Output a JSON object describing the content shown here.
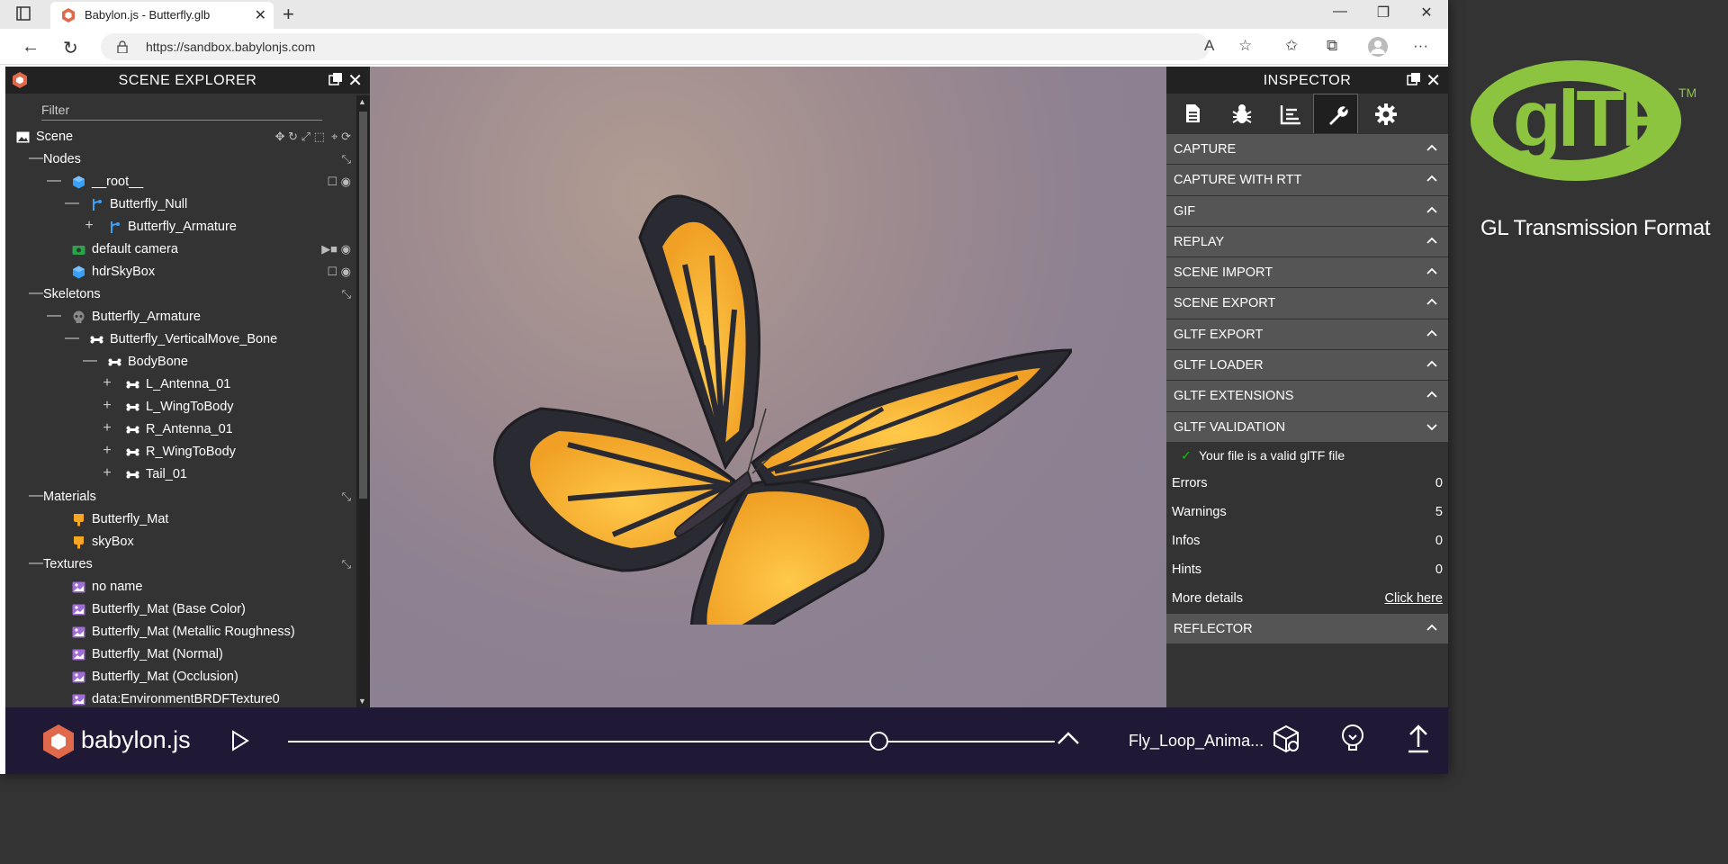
{
  "browser": {
    "tab_title": "Babylon.js - Butterfly.glb",
    "url": "https://sandbox.babylonjs.com"
  },
  "explorer": {
    "title": "SCENE EXPLORER",
    "filter_placeholder": "Filter",
    "tree": [
      {
        "label": "Scene",
        "level": 0,
        "icon": "image-icon",
        "expander": ""
      },
      {
        "label": "Nodes",
        "level": 1,
        "icon": "",
        "expander": "—"
      },
      {
        "label": "__root__",
        "level": 2,
        "icon": "cube-icon",
        "expander": "—"
      },
      {
        "label": "Butterfly_Null",
        "level": 3,
        "icon": "branch-icon",
        "expander": "—"
      },
      {
        "label": "Butterfly_Armature",
        "level": 4,
        "icon": "branch-icon",
        "expander": "+"
      },
      {
        "label": "default camera",
        "level": 2,
        "icon": "camera-icon",
        "expander": ""
      },
      {
        "label": "hdrSkyBox",
        "level": 2,
        "icon": "cube-icon",
        "expander": ""
      },
      {
        "label": "Skeletons",
        "level": 1,
        "icon": "",
        "expander": "—"
      },
      {
        "label": "Butterfly_Armature",
        "level": 2,
        "icon": "skull-icon",
        "expander": "—"
      },
      {
        "label": "Butterfly_VerticalMove_Bone",
        "level": 3,
        "icon": "bone-icon",
        "expander": "—"
      },
      {
        "label": "BodyBone",
        "level": 4,
        "icon": "bone-icon",
        "expander": "—"
      },
      {
        "label": "L_Antenna_01",
        "level": 5,
        "icon": "bone-icon",
        "expander": "+"
      },
      {
        "label": "L_WingToBody",
        "level": 5,
        "icon": "bone-icon",
        "expander": "+"
      },
      {
        "label": "R_Antenna_01",
        "level": 5,
        "icon": "bone-icon",
        "expander": "+"
      },
      {
        "label": "R_WingToBody",
        "level": 5,
        "icon": "bone-icon",
        "expander": "+"
      },
      {
        "label": "Tail_01",
        "level": 5,
        "icon": "bone-icon",
        "expander": "+"
      },
      {
        "label": "Materials",
        "level": 1,
        "icon": "",
        "expander": "—"
      },
      {
        "label": "Butterfly_Mat",
        "level": 2,
        "icon": "material-icon",
        "expander": ""
      },
      {
        "label": "skyBox",
        "level": 2,
        "icon": "material-icon",
        "expander": ""
      },
      {
        "label": "Textures",
        "level": 1,
        "icon": "",
        "expander": "—"
      },
      {
        "label": "no name",
        "level": 2,
        "icon": "texture-icon",
        "expander": ""
      },
      {
        "label": "Butterfly_Mat (Base Color)",
        "level": 2,
        "icon": "texture-icon",
        "expander": ""
      },
      {
        "label": "Butterfly_Mat (Metallic Roughness)",
        "level": 2,
        "icon": "texture-icon",
        "expander": ""
      },
      {
        "label": "Butterfly_Mat (Normal)",
        "level": 2,
        "icon": "texture-icon",
        "expander": ""
      },
      {
        "label": "Butterfly_Mat (Occlusion)",
        "level": 2,
        "icon": "texture-icon",
        "expander": ""
      },
      {
        "label": "data:EnvironmentBRDFTexture0",
        "level": 2,
        "icon": "texture-icon",
        "expander": ""
      }
    ]
  },
  "inspector": {
    "title": "INSPECTOR",
    "tools": [
      "document-icon",
      "bug-icon",
      "chart-icon",
      "wrench-icon",
      "gear-icon"
    ],
    "selected_tool": "wrench-icon",
    "sections_top": [
      "CAPTURE",
      "CAPTURE WITH RTT",
      "GIF",
      "REPLAY",
      "SCENE IMPORT",
      "SCENE EXPORT",
      "GLTF EXPORT",
      "GLTF LOADER",
      "GLTF EXTENSIONS",
      "GLTF VALIDATION"
    ],
    "validation_message": "Your file is a valid glTF file",
    "stats": [
      {
        "key": "Errors",
        "value": "0"
      },
      {
        "key": "Warnings",
        "value": "5"
      },
      {
        "key": "Infos",
        "value": "0"
      },
      {
        "key": "Hints",
        "value": "0"
      }
    ],
    "more_details_label": "More details",
    "more_details_link": "Click here",
    "sections_bottom": [
      "REFLECTOR"
    ]
  },
  "footer": {
    "brand": "babylon.js",
    "animation_name": "Fly_Loop_Anima...",
    "timeline_position": 0.77
  },
  "gltf_logo": {
    "subtitle": "GL Transmission Format",
    "brand_color": "#8cc43f"
  },
  "colors": {
    "panel_bg": "#333333",
    "section_bg": "#555555",
    "footer_bg": "#201936",
    "accent_purple": "#a26bd6",
    "accent_blue": "#3a9ff7",
    "accent_orange": "#f5a623"
  }
}
